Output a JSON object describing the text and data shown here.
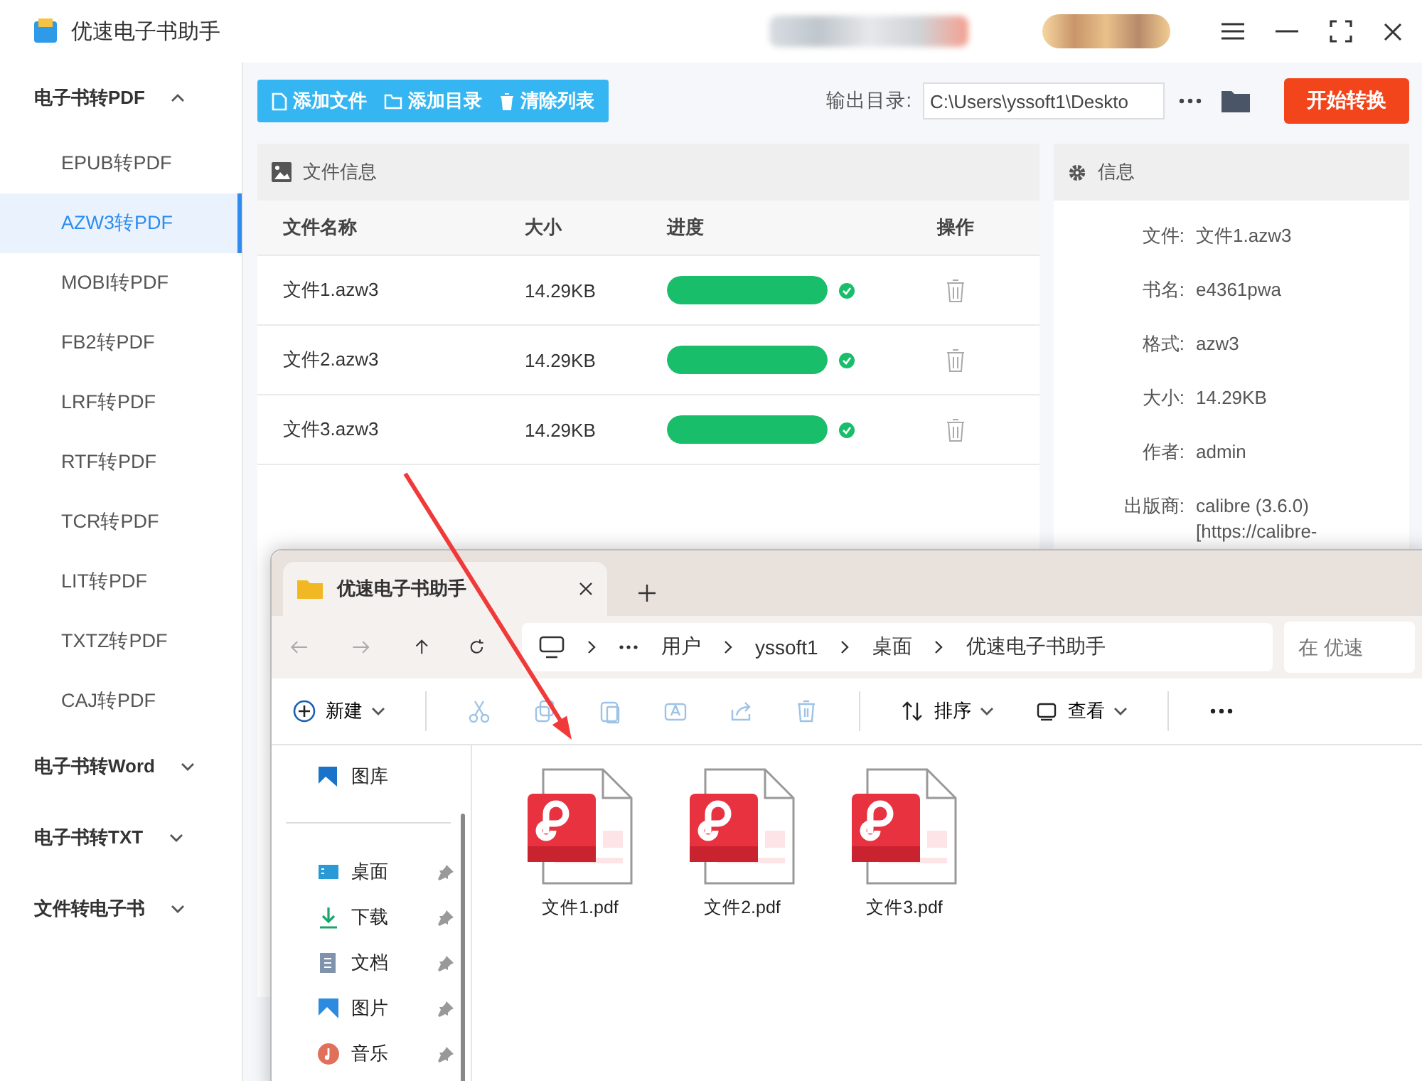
{
  "window": {
    "title": "优速电子书助手"
  },
  "sidebar": {
    "groups": [
      {
        "label": "电子书转PDF",
        "expanded": true,
        "items": [
          {
            "label": "EPUB转PDF",
            "selected": false
          },
          {
            "label": "AZW3转PDF",
            "selected": true
          },
          {
            "label": "MOBI转PDF",
            "selected": false
          },
          {
            "label": "FB2转PDF",
            "selected": false
          },
          {
            "label": "LRF转PDF",
            "selected": false
          },
          {
            "label": "RTF转PDF",
            "selected": false
          },
          {
            "label": "TCR转PDF",
            "selected": false
          },
          {
            "label": "LIT转PDF",
            "selected": false
          },
          {
            "label": "TXTZ转PDF",
            "selected": false
          },
          {
            "label": "CAJ转PDF",
            "selected": false
          }
        ]
      },
      {
        "label": "电子书转Word",
        "expanded": false
      },
      {
        "label": "电子书转TXT",
        "expanded": false
      },
      {
        "label": "文件转电子书",
        "expanded": false
      }
    ]
  },
  "toolbar": {
    "buttons": [
      {
        "kind": "file",
        "label": "添加文件"
      },
      {
        "kind": "folder",
        "label": "添加目录"
      },
      {
        "kind": "trash",
        "label": "清除列表"
      }
    ],
    "output_label": "输出目录:",
    "output_path": "C:\\Users\\yssoft1\\Deskto",
    "start_button": "开始转换"
  },
  "file_panel": {
    "title": "文件信息",
    "columns": [
      "文件名称",
      "大小",
      "进度",
      "操作"
    ],
    "rows": [
      {
        "name": "文件1.azw3",
        "size": "14.29KB",
        "level": 1,
        "done": true
      },
      {
        "name": "文件2.azw3",
        "size": "14.29KB",
        "level": 1,
        "done": true
      },
      {
        "name": "文件3.azw3",
        "size": "14.29KB",
        "level": 1,
        "done": true
      }
    ]
  },
  "info_panel": {
    "title": "信息",
    "fields": [
      {
        "label": "文件:",
        "value": "文件1.azw3"
      },
      {
        "label": "书名:",
        "value": "e4361pwa"
      },
      {
        "label": "格式:",
        "value": "azw3"
      },
      {
        "label": "大小:",
        "value": "14.29KB"
      },
      {
        "label": "作者:",
        "value": "admin"
      },
      {
        "label": "出版商:",
        "value": "calibre (3.6.0) [https://calibre-"
      }
    ]
  },
  "explorer": {
    "tab_title": "优速电子书助手",
    "breadcrumbs": [
      "用户",
      "yssoft1",
      "桌面",
      "优速电子书助手"
    ],
    "search": {
      "placeholder": "在 优速"
    },
    "commands": [
      {
        "kind": "new",
        "label": "新建",
        "disabled": false
      },
      {
        "kind": "cut",
        "disabled": true
      },
      {
        "kind": "copy",
        "disabled": true
      },
      {
        "kind": "paste",
        "disabled": true
      },
      {
        "kind": "rename",
        "disabled": true
      },
      {
        "kind": "share",
        "disabled": true
      },
      {
        "kind": "delete",
        "disabled": true
      },
      {
        "kind": "sort",
        "label": "排序",
        "disabled": false
      },
      {
        "kind": "view",
        "label": "查看",
        "disabled": false
      },
      {
        "kind": "more",
        "disabled": false
      }
    ],
    "nav": [
      {
        "kind": "gallery",
        "label": "图库",
        "pinned": false
      },
      {
        "kind": "desktop",
        "label": "桌面",
        "pinned": true
      },
      {
        "kind": "download",
        "label": "下载",
        "pinned": true
      },
      {
        "kind": "docs",
        "label": "文档",
        "pinned": true
      },
      {
        "kind": "pictures",
        "label": "图片",
        "pinned": true
      },
      {
        "kind": "music",
        "label": "音乐",
        "pinned": true
      }
    ],
    "files": [
      {
        "name": "文件1.pdf"
      },
      {
        "name": "文件2.pdf"
      },
      {
        "name": "文件3.pdf"
      }
    ]
  }
}
